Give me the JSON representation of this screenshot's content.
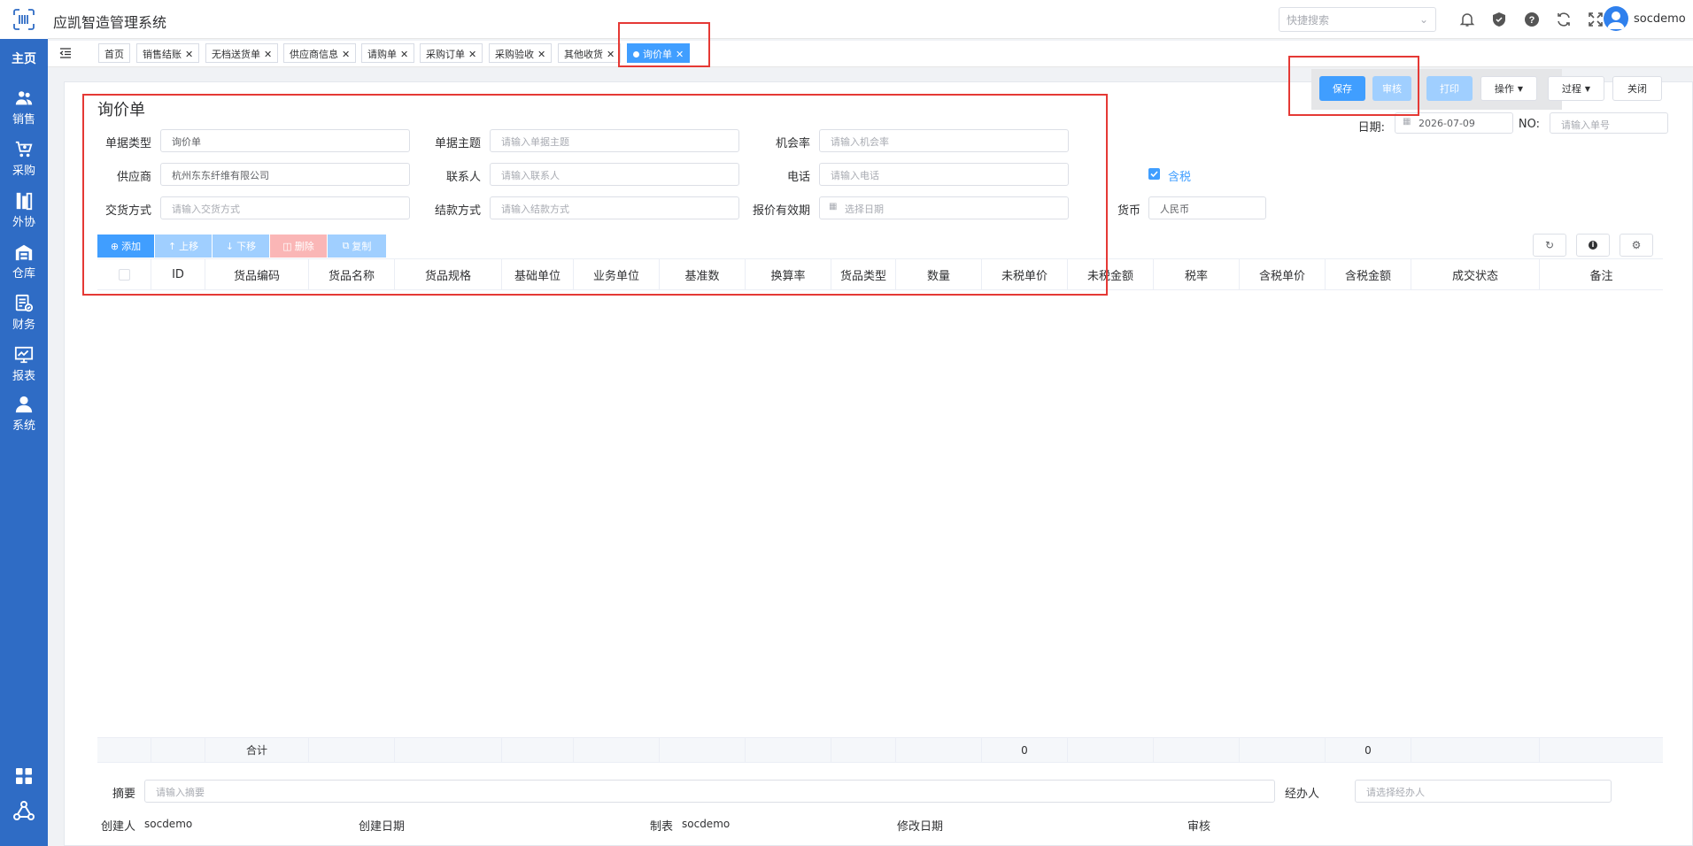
{
  "app": {
    "title": "应凯智造管理系统",
    "logo_icon": "barcode-scan-icon"
  },
  "header": {
    "search_placeholder": "快捷搜索",
    "icons": [
      "bell-icon",
      "shield-icon",
      "help-icon",
      "refresh-icon",
      "fullscreen-icon"
    ],
    "username": "socdemo"
  },
  "sidebar": {
    "home": "主页",
    "items": [
      {
        "label": "销售",
        "icon": "users-icon"
      },
      {
        "label": "采购",
        "icon": "cart-icon"
      },
      {
        "label": "外协",
        "icon": "outsource-icon"
      },
      {
        "label": "仓库",
        "icon": "warehouse-icon"
      },
      {
        "label": "财务",
        "icon": "finance-icon"
      },
      {
        "label": "报表",
        "icon": "chart-icon"
      },
      {
        "label": "系统",
        "icon": "user-icon"
      }
    ],
    "bottom_icons": [
      "apps-grid-icon",
      "network-icon"
    ]
  },
  "tabs": [
    {
      "label": "首页",
      "closable": false
    },
    {
      "label": "销售结账",
      "closable": true
    },
    {
      "label": "无档送货单",
      "closable": true
    },
    {
      "label": "供应商信息",
      "closable": true
    },
    {
      "label": "请购单",
      "closable": true
    },
    {
      "label": "采购订单",
      "closable": true
    },
    {
      "label": "采购验收",
      "closable": true
    },
    {
      "label": "其他收货",
      "closable": true
    },
    {
      "label": "询价单",
      "closable": true,
      "active": true
    }
  ],
  "toolbar": {
    "save": "保存",
    "audit": "审核",
    "print": "打印",
    "operate": "操作",
    "process": "过程",
    "close": "关闭"
  },
  "form": {
    "title": "询价单",
    "doc_type_label": "单据类型",
    "doc_type_value": "询价单",
    "subject_label": "单据主题",
    "subject_placeholder": "请输入单据主题",
    "chance_label": "机会率",
    "chance_placeholder": "请输入机会率",
    "date_label": "日期:",
    "date_value": "2026-07-09",
    "no_label": "NO:",
    "no_placeholder": "请输入单号",
    "supplier_label": "供应商",
    "supplier_value": "杭州东东纤维有限公司",
    "contact_label": "联系人",
    "contact_placeholder": "请输入联系人",
    "phone_label": "电话",
    "phone_placeholder": "请输入电话",
    "tax_included_label": "含税",
    "tax_included": true,
    "delivery_label": "交货方式",
    "delivery_placeholder": "请输入交货方式",
    "settle_label": "结款方式",
    "settle_placeholder": "请输入结款方式",
    "validity_label": "报价有效期",
    "validity_placeholder": "选择日期",
    "currency_label": "货币",
    "currency_value": "人民币"
  },
  "grid_buttons": {
    "add": "添加",
    "up": "上移",
    "down": "下移",
    "delete": "删除",
    "copy": "复制"
  },
  "table": {
    "columns": [
      "ID",
      "货品编码",
      "货品名称",
      "货品规格",
      "基础单位",
      "业务单位",
      "基准数",
      "换算率",
      "货品类型",
      "数量",
      "未税单价",
      "未税金额",
      "税率",
      "含税单价",
      "含税金额",
      "成交状态",
      "备注"
    ],
    "footer_label": "合计",
    "footer_untaxed_total": "0",
    "footer_taxed_total": "0"
  },
  "bottom": {
    "summary_label": "摘要",
    "summary_placeholder": "请输入摘要",
    "handler_label": "经办人",
    "handler_placeholder": "请选择经办人",
    "creator_label": "创建人",
    "creator_value": "socdemo",
    "created_date_label": "创建日期",
    "maker_label": "制表",
    "maker_value": "socdemo",
    "modified_date_label": "修改日期",
    "auditor_label": "审核"
  }
}
